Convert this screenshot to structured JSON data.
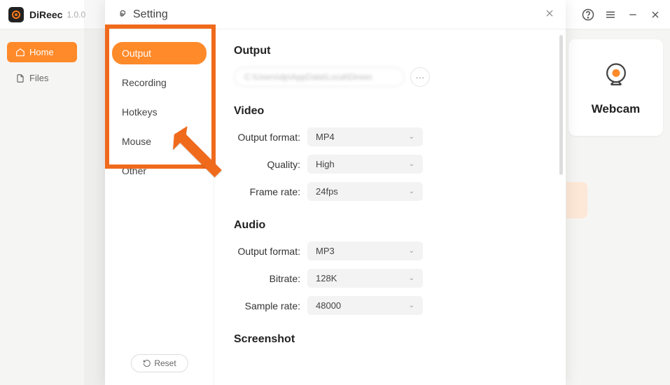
{
  "app": {
    "name": "DiReec",
    "version": "1.0.0"
  },
  "sidebar": {
    "items": [
      {
        "label": "Home",
        "icon": "home-icon",
        "active": true
      },
      {
        "label": "Files",
        "icon": "files-icon",
        "active": false
      }
    ]
  },
  "webcam": {
    "label": "Webcam"
  },
  "settings_modal": {
    "title": "Setting",
    "tabs": [
      "Output",
      "Recording",
      "Hotkeys",
      "Mouse",
      "Other"
    ],
    "active_tab": "Output",
    "reset_label": "Reset",
    "sections": {
      "output": {
        "heading": "Output",
        "path_display": "C:\\Users\\dp\\AppData\\Local\\Direec"
      },
      "video": {
        "heading": "Video",
        "rows": [
          {
            "label": "Output format:",
            "value": "MP4"
          },
          {
            "label": "Quality:",
            "value": "High"
          },
          {
            "label": "Frame rate:",
            "value": "24fps"
          }
        ]
      },
      "audio": {
        "heading": "Audio",
        "rows": [
          {
            "label": "Output format:",
            "value": "MP3"
          },
          {
            "label": "Bitrate:",
            "value": "128K"
          },
          {
            "label": "Sample rate:",
            "value": "48000"
          }
        ]
      },
      "screenshot": {
        "heading": "Screenshot"
      }
    }
  }
}
